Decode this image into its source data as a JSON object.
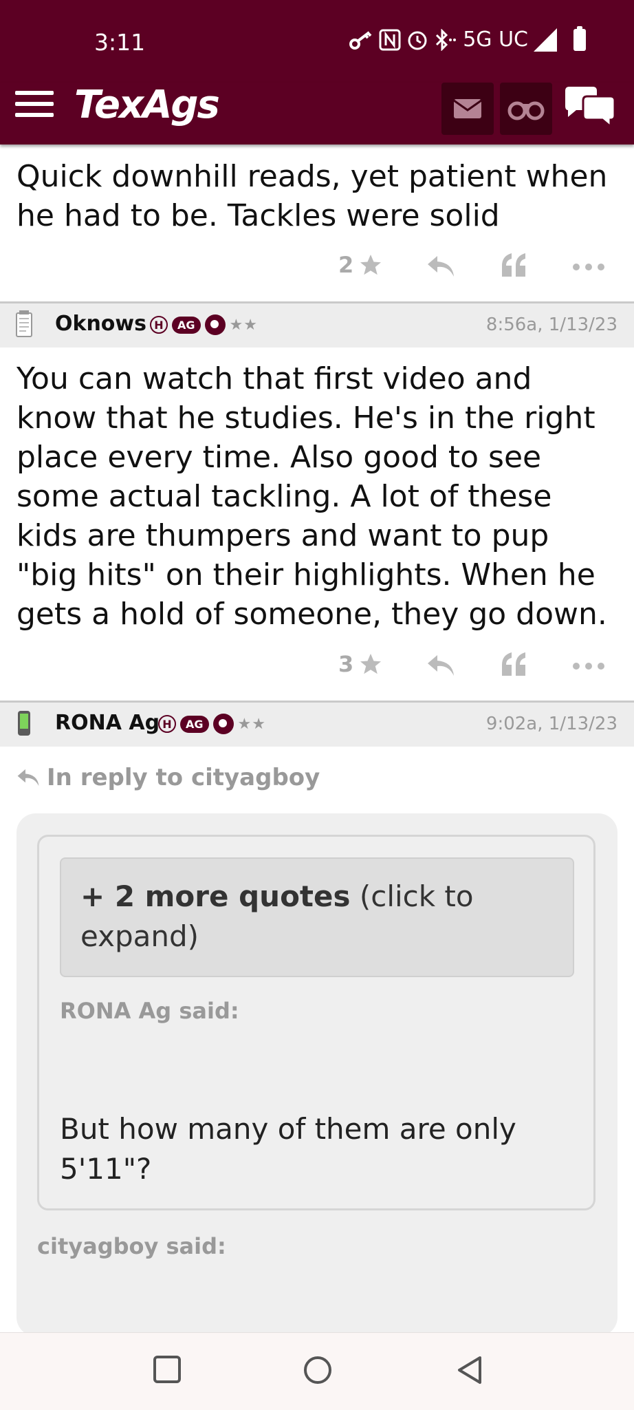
{
  "status_bar": {
    "time": "3:11",
    "network": "5G UC"
  },
  "header": {
    "logo": "TexAgs"
  },
  "posts": [
    {
      "body": "Quick downhill reads, yet patient when he had to be. Tackles were solid",
      "likes": "2"
    },
    {
      "username": "Oknows",
      "badge_h": "H",
      "badge_ag": "AG",
      "stars": "★★",
      "time": "8:56a, 1/13/23",
      "body": "You can watch that first video and know that he studies. He's in the right place every time. Also good to see some actual tackling. A lot of these kids are thumpers and want to pup \"big hits\" on their highlights. When he gets a hold of someone, they go down.",
      "likes": "3"
    },
    {
      "username": "RONA Ag",
      "badge_h": "H",
      "badge_ag": "AG",
      "stars": "★★",
      "time": "9:02a, 1/13/23",
      "reply_to": "In reply to cityagboy",
      "more_quotes_bold": "+ 2 more quotes",
      "more_quotes_rest": " (click to expand)",
      "inner_said": "RONA Ag said:",
      "inner_quote": "But how many of them are only 5'11\"?",
      "outer_said": "cityagboy said:"
    }
  ],
  "icons": [
    "menu-icon",
    "mail-icon",
    "binoculars-icon",
    "chat-icon",
    "star-icon",
    "reply-icon",
    "quote-icon",
    "more-icon",
    "square-icon",
    "circle-icon",
    "back-icon"
  ],
  "colors": {
    "brand": "#5c0023",
    "muted": "#999999"
  }
}
